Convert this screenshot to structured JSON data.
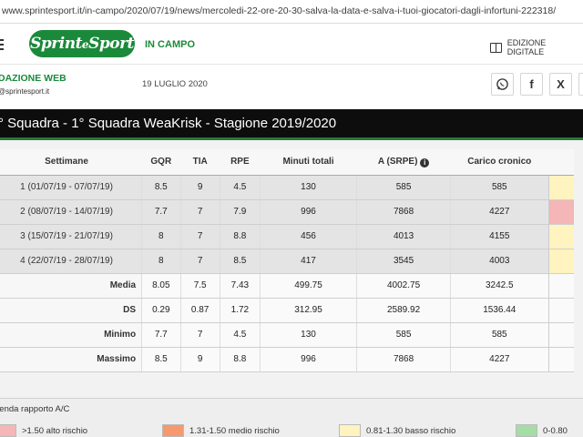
{
  "browser": {
    "url": "www.sprintesport.it/in-campo/2020/07/19/news/mercoledi-22-ore-20-30-salva-la-data-e-salva-i-tuoi-giocatori-dagli-infortuni-222318/"
  },
  "header": {
    "logo_text": "Sprint e Sport",
    "section": "IN CAMPO",
    "edizione_label": "EDIZIONE DIGITALE"
  },
  "byline": {
    "author": "DAZIONE WEB",
    "email": "@sprintesport.it",
    "date": "19 LUGLIO 2020"
  },
  "share": [
    "whatsapp-icon",
    "facebook-icon",
    "x-icon"
  ],
  "figure": {
    "title": "° Squadra - 1° Squadra WeaKrisk - Stagione 2019/2020",
    "columns": [
      "Settimane",
      "GQR",
      "TIA",
      "RPE",
      "Minuti totali",
      "A (SRPE)",
      "Carico cronico"
    ],
    "rows": [
      {
        "label": "1 (01/07/19 - 07/07/19)",
        "gqr": "8.5",
        "tia": "9",
        "rpe": "4.5",
        "minuti": "130",
        "asrpe": "585",
        "cronico": "585",
        "ac_color": "#fff3bf"
      },
      {
        "label": "2 (08/07/19 - 14/07/19)",
        "gqr": "7.7",
        "tia": "7",
        "rpe": "7.9",
        "minuti": "996",
        "asrpe": "7868",
        "cronico": "4227",
        "ac_color": "#f4b6b6"
      },
      {
        "label": "3 (15/07/19 - 21/07/19)",
        "gqr": "8",
        "tia": "7",
        "rpe": "8.8",
        "minuti": "456",
        "asrpe": "4013",
        "cronico": "4155",
        "ac_color": "#fff3bf"
      },
      {
        "label": "4 (22/07/19 - 28/07/19)",
        "gqr": "8",
        "tia": "7",
        "rpe": "8.5",
        "minuti": "417",
        "asrpe": "3545",
        "cronico": "4003",
        "ac_color": "#fff3bf"
      }
    ],
    "stats": [
      {
        "label": "Media",
        "gqr": "8.05",
        "tia": "7.5",
        "rpe": "7.43",
        "minuti": "499.75",
        "asrpe": "4002.75",
        "cronico": "3242.5"
      },
      {
        "label": "DS",
        "gqr": "0.29",
        "tia": "0.87",
        "rpe": "1.72",
        "minuti": "312.95",
        "asrpe": "2589.92",
        "cronico": "1536.44"
      },
      {
        "label": "Minimo",
        "gqr": "7.7",
        "tia": "7",
        "rpe": "4.5",
        "minuti": "130",
        "asrpe": "585",
        "cronico": "585"
      },
      {
        "label": "Massimo",
        "gqr": "8.5",
        "tia": "9",
        "rpe": "8.8",
        "minuti": "996",
        "asrpe": "7868",
        "cronico": "4227"
      }
    ],
    "legend": {
      "title": "genda rapporto A/C",
      "items": [
        {
          "label": ">1.50 alto rischio",
          "color": "#f4b6b6"
        },
        {
          "label": "1.31-1.50 medio rischio",
          "color": "#f59a6e"
        },
        {
          "label": "0.81-1.30 basso rischio",
          "color": "#fff3bf"
        },
        {
          "label": "0-0.80",
          "color": "#a6dca6"
        }
      ]
    }
  }
}
